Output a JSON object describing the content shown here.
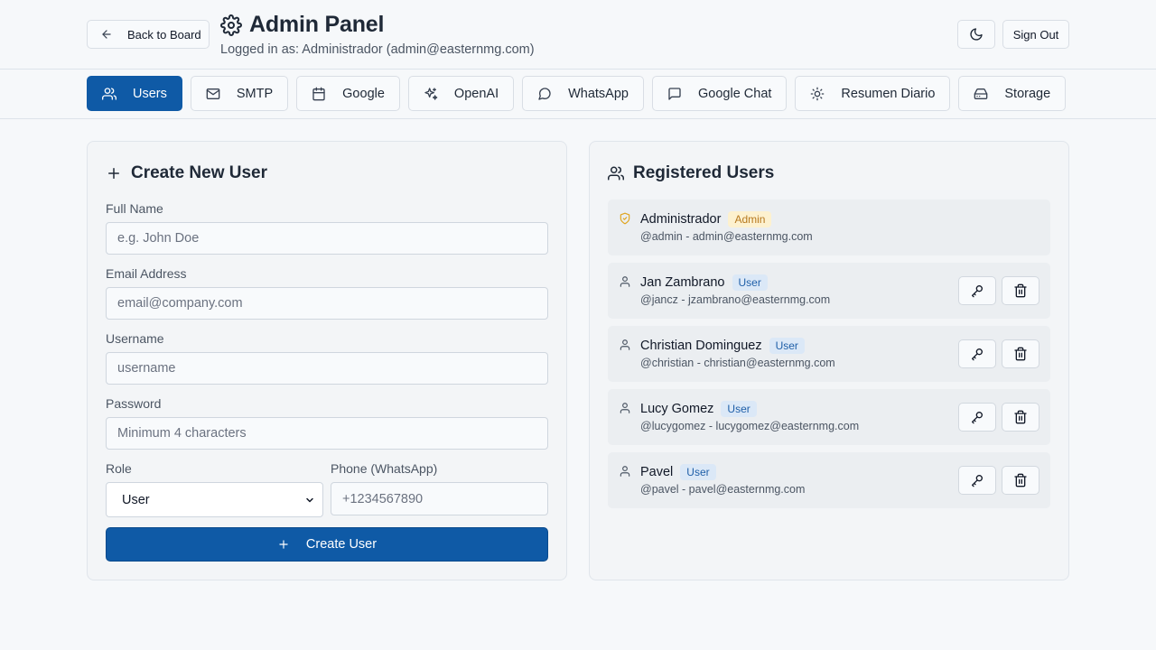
{
  "header": {
    "back_label": "Back to Board",
    "title": "Admin Panel",
    "subtitle": "Logged in as: Administrador (admin@easternmg.com)",
    "signout_label": "Sign Out"
  },
  "tabs": [
    {
      "label": "Users",
      "icon": "users-icon",
      "active": true
    },
    {
      "label": "SMTP",
      "icon": "mail-icon"
    },
    {
      "label": "Google",
      "icon": "calendar-icon"
    },
    {
      "label": "OpenAI",
      "icon": "sparkles-icon"
    },
    {
      "label": "WhatsApp",
      "icon": "message-circle-icon"
    },
    {
      "label": "Google Chat",
      "icon": "message-square-icon"
    },
    {
      "label": "Resumen Diario",
      "icon": "sun-icon"
    },
    {
      "label": "Storage",
      "icon": "hard-drive-icon"
    }
  ],
  "create_form": {
    "title": "Create New User",
    "full_name_label": "Full Name",
    "full_name_placeholder": "e.g. John Doe",
    "email_label": "Email Address",
    "email_placeholder": "email@company.com",
    "username_label": "Username",
    "username_placeholder": "username",
    "password_label": "Password",
    "password_placeholder": "Minimum 4 characters",
    "role_label": "Role",
    "role_value": "User",
    "phone_label": "Phone (WhatsApp)",
    "phone_placeholder": "+1234567890",
    "submit_label": "Create User"
  },
  "users_panel": {
    "title": "Registered Users",
    "users": [
      {
        "name": "Administrador",
        "role": "Admin",
        "meta": "@admin - admin@easternmg.com",
        "is_admin": true
      },
      {
        "name": "Jan Zambrano",
        "role": "User",
        "meta": "@jancz - jzambrano@easternmg.com"
      },
      {
        "name": "Christian Dominguez",
        "role": "User",
        "meta": "@christian - christian@easternmg.com"
      },
      {
        "name": "Lucy Gomez",
        "role": "User",
        "meta": "@lucygomez - lucygomez@easternmg.com"
      },
      {
        "name": "Pavel",
        "role": "User",
        "meta": "@pavel - pavel@easternmg.com"
      }
    ]
  },
  "colors": {
    "primary": "#0f5aa6",
    "admin_badge_bg": "#fdf1cf",
    "admin_badge_text": "#b7791f",
    "user_badge_bg": "#dbe8f7",
    "user_badge_text": "#1f5fa8"
  }
}
